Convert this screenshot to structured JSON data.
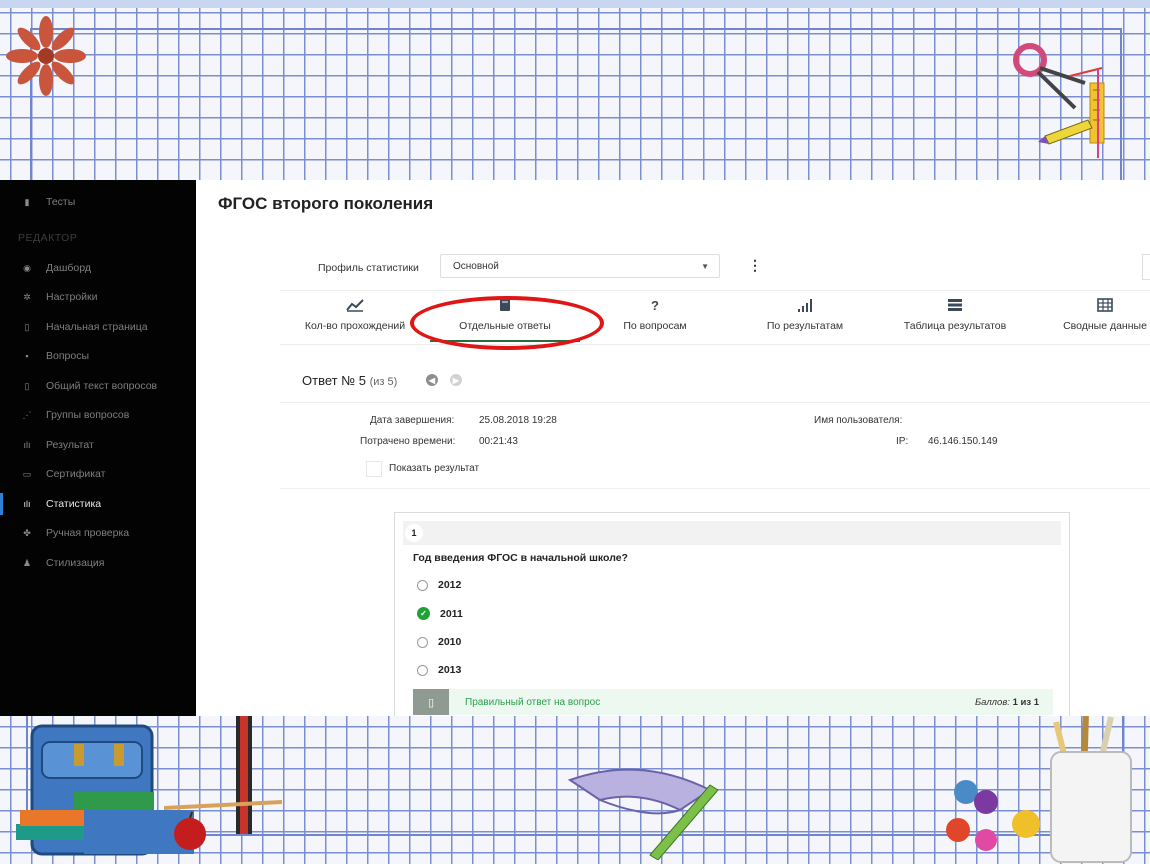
{
  "sidebar": {
    "top_item": {
      "label": "Тесты",
      "icon": "document-icon"
    },
    "section_heading": "РЕДАКТОР",
    "items": [
      {
        "label": "Дашборд",
        "icon": "dashboard-icon"
      },
      {
        "label": "Настройки",
        "icon": "gear-icon"
      },
      {
        "label": "Начальная страница",
        "icon": "page-icon"
      },
      {
        "label": "Вопросы",
        "icon": "questions-icon"
      },
      {
        "label": "Общий текст вопросов",
        "icon": "text-icon"
      },
      {
        "label": "Группы вопросов",
        "icon": "groups-icon"
      },
      {
        "label": "Результат",
        "icon": "result-icon"
      },
      {
        "label": "Сертификат",
        "icon": "certificate-icon"
      },
      {
        "label": "Статистика",
        "icon": "bar-chart-icon",
        "active": true
      },
      {
        "label": "Ручная проверка",
        "icon": "paw-icon"
      },
      {
        "label": "Стилизация",
        "icon": "style-icon"
      }
    ]
  },
  "page": {
    "title": "ФГОС второго поколения"
  },
  "profile": {
    "label": "Профиль статистики",
    "selected": "Основной"
  },
  "tabs": [
    {
      "label": "Кол-во прохождений",
      "icon": "line-chart-icon"
    },
    {
      "label": "Отдельные ответы",
      "icon": "book-icon",
      "active": true
    },
    {
      "label": "По вопросам",
      "icon": "question-mark-icon"
    },
    {
      "label": "По результатам",
      "icon": "signal-bars-icon"
    },
    {
      "label": "Таблица результатов",
      "icon": "server-list-icon"
    },
    {
      "label": "Сводные данные",
      "icon": "table-icon"
    }
  ],
  "answer": {
    "heading": "Ответ № 5",
    "of_text": "(из 5)",
    "completion_label": "Дата завершения:",
    "completion_value": "25.08.2018 19:28",
    "time_label": "Потрачено времени:",
    "time_value": "00:21:43",
    "user_label": "Имя пользователя:",
    "ip_label": "IP:",
    "ip_value": "46.146.150.149",
    "show_result_label": "Показать результат"
  },
  "question": {
    "number": "1",
    "text": "Год введения ФГОС в начальной школе?",
    "options": [
      {
        "label": "2012",
        "selected": false
      },
      {
        "label": "2011",
        "selected": true
      },
      {
        "label": "2010",
        "selected": false
      },
      {
        "label": "2013",
        "selected": false
      }
    ],
    "result_text": "Правильный ответ на вопрос",
    "score_label": "Баллов:",
    "score_value": "1 из 1"
  },
  "colors": {
    "sidebar_bg": "#030303",
    "accent_active": "#2e7fd6",
    "highlight_oval": "#e01515",
    "correct_green": "#21a038",
    "grid_line": "#7a8fd0"
  }
}
